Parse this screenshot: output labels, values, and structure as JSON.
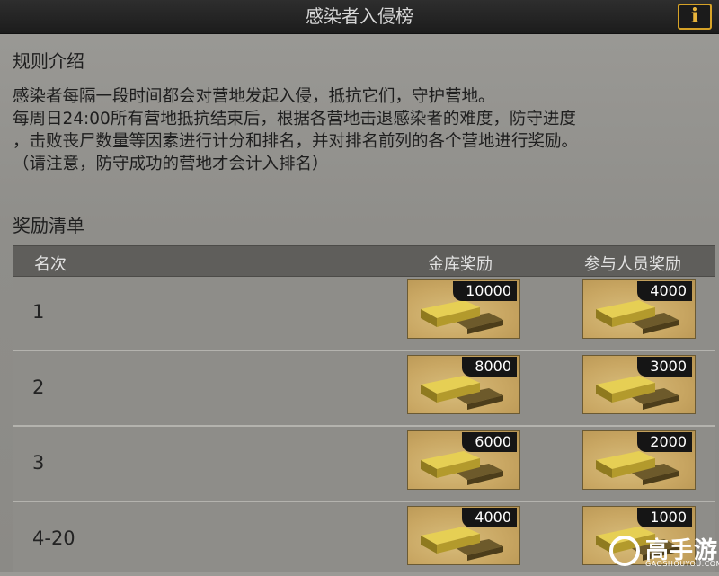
{
  "header": {
    "title": "感染者入侵榜",
    "info_icon": "i"
  },
  "rules": {
    "heading": "规则介绍",
    "lines": [
      "感染者每隔一段时间都会对营地发起入侵，抵抗它们，守护营地。",
      "每周日24:00所有营地抵抗结束后，根据各营地击退感染者的难度，防守进度",
      "，击败丧尸数量等因素进行计分和排名，并对排名前列的各个营地进行奖励。",
      "（请注意，防守成功的营地才会计入排名）"
    ]
  },
  "rewards": {
    "heading": "奖励清单",
    "columns": {
      "rank": "名次",
      "vault": "金库奖励",
      "member": "参与人员奖励"
    },
    "rows": [
      {
        "rank": "1",
        "vault": "10000",
        "member": "4000"
      },
      {
        "rank": "2",
        "vault": "8000",
        "member": "3000"
      },
      {
        "rank": "3",
        "vault": "6000",
        "member": "2000"
      },
      {
        "rank": "4-20",
        "vault": "4000",
        "member": "1000"
      }
    ],
    "reward_icon": "gold-bars-icon"
  },
  "watermark": {
    "brand": "高手游",
    "domain": "GAOSHOUYOU.COM"
  },
  "colors": {
    "accent": "#d6a227",
    "header_bg": "#1c1c1c",
    "reward_bg": "#c9a763"
  }
}
